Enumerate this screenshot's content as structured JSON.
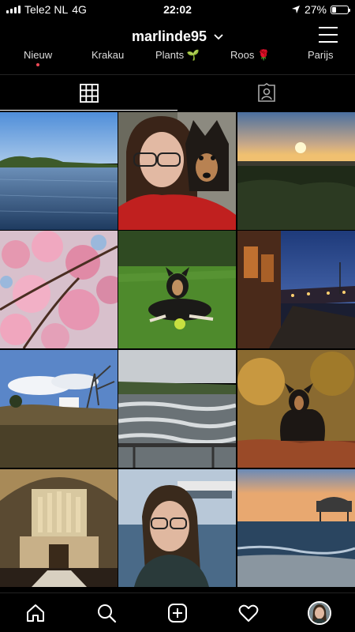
{
  "status": {
    "carrier": "Tele2 NL",
    "network": "4G",
    "time": "22:02",
    "battery": "27%",
    "battery_level": 0.27
  },
  "header": {
    "username": "marlinde95"
  },
  "highlights": [
    {
      "label": "Nieuw",
      "has_dot": true
    },
    {
      "label": "Krakau"
    },
    {
      "label": "Plants 🌱"
    },
    {
      "label": "Roos 🌹"
    },
    {
      "label": "Parijs"
    }
  ],
  "tabs": {
    "active": "grid"
  },
  "grid": [
    {
      "subject": "river landscape under blue sky"
    },
    {
      "subject": "selfie with dog"
    },
    {
      "subject": "sunset over heathland"
    },
    {
      "subject": "pink cherry blossom"
    },
    {
      "subject": "dog lying on lawn with ball"
    },
    {
      "subject": "harbour at dusk"
    },
    {
      "subject": "heath with white buildings"
    },
    {
      "subject": "rushing river weir"
    },
    {
      "subject": "dog in autumn leaves"
    },
    {
      "subject": "church interior with organ"
    },
    {
      "subject": "selfie at pier"
    },
    {
      "subject": "beach and pier at sunset"
    }
  ],
  "colors": {
    "background": "#000000",
    "notification_dot": "#ed4956"
  }
}
